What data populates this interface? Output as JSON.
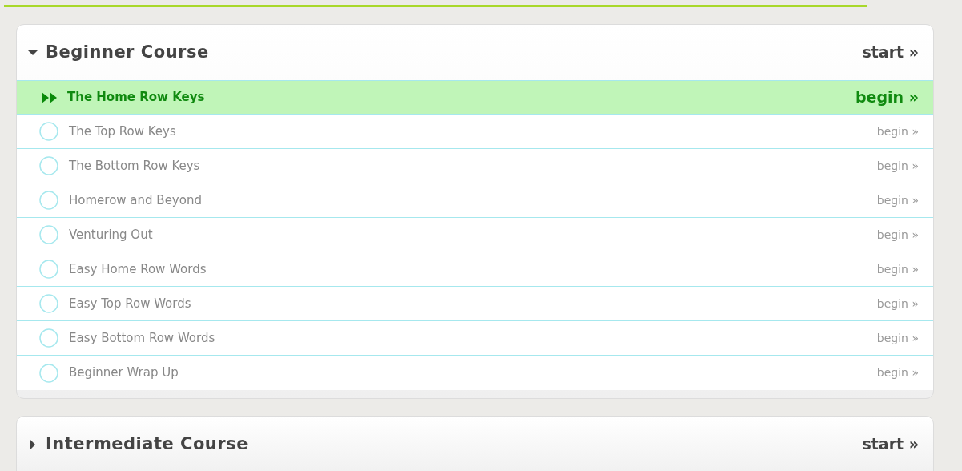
{
  "courses": [
    {
      "title": "Beginner Course",
      "action": "start »",
      "expanded": true,
      "lessons": [
        {
          "title": "The Home Row Keys",
          "action": "begin »",
          "selected": true
        },
        {
          "title": "The Top Row Keys",
          "action": "begin »",
          "selected": false
        },
        {
          "title": "The Bottom Row Keys",
          "action": "begin »",
          "selected": false
        },
        {
          "title": "Homerow and Beyond",
          "action": "begin »",
          "selected": false
        },
        {
          "title": "Venturing Out",
          "action": "begin »",
          "selected": false
        },
        {
          "title": "Easy Home Row Words",
          "action": "begin »",
          "selected": false
        },
        {
          "title": "Easy Top Row Words",
          "action": "begin »",
          "selected": false
        },
        {
          "title": "Easy Bottom Row Words",
          "action": "begin »",
          "selected": false
        },
        {
          "title": "Beginner Wrap Up",
          "action": "begin »",
          "selected": false
        }
      ]
    },
    {
      "title": "Intermediate Course",
      "action": "start »",
      "expanded": false
    }
  ]
}
